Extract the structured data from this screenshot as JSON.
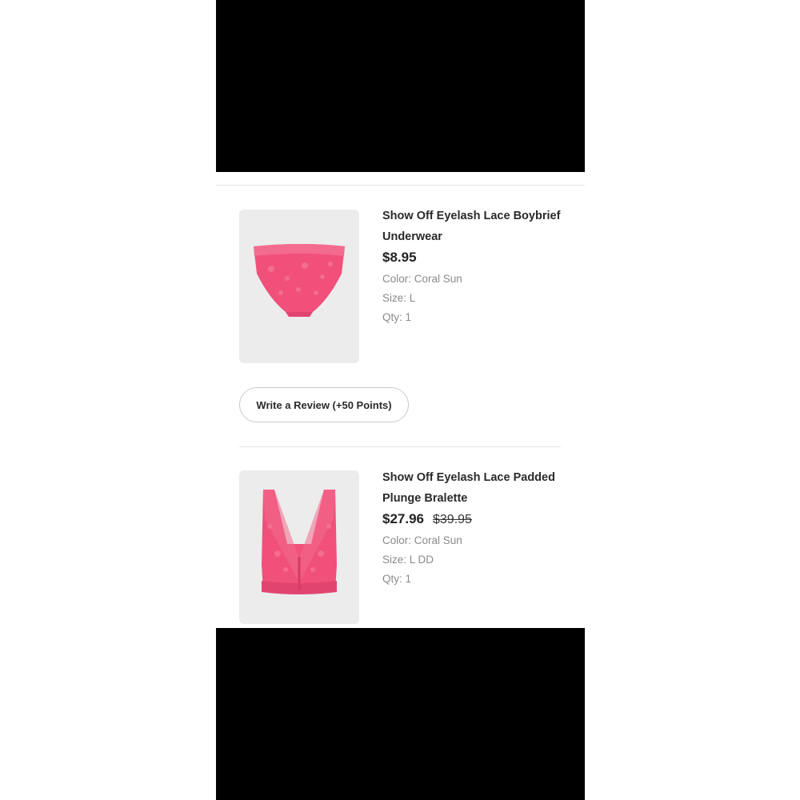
{
  "items": [
    {
      "title": "Show Off Eyelash Lace Boybrief Underwear",
      "price": "$8.95",
      "original_price": "",
      "color": "Color: Coral Sun",
      "size": "Size: L",
      "qty": "Qty: 1",
      "image_icon": "boybrief-underwear-image"
    },
    {
      "title": "Show Off Eyelash Lace Padded Plunge Bralette",
      "price": "$27.96",
      "original_price": "$39.95",
      "color": "Color: Coral Sun",
      "size": "Size: L DD",
      "qty": "Qty: 1",
      "image_icon": "plunge-bralette-image"
    }
  ],
  "review_button": {
    "label": "Write a Review (+50 Points)"
  },
  "colors": {
    "product_pink": "#f0507a",
    "thumb_background": "#ececec",
    "letterbox": "#000000"
  }
}
